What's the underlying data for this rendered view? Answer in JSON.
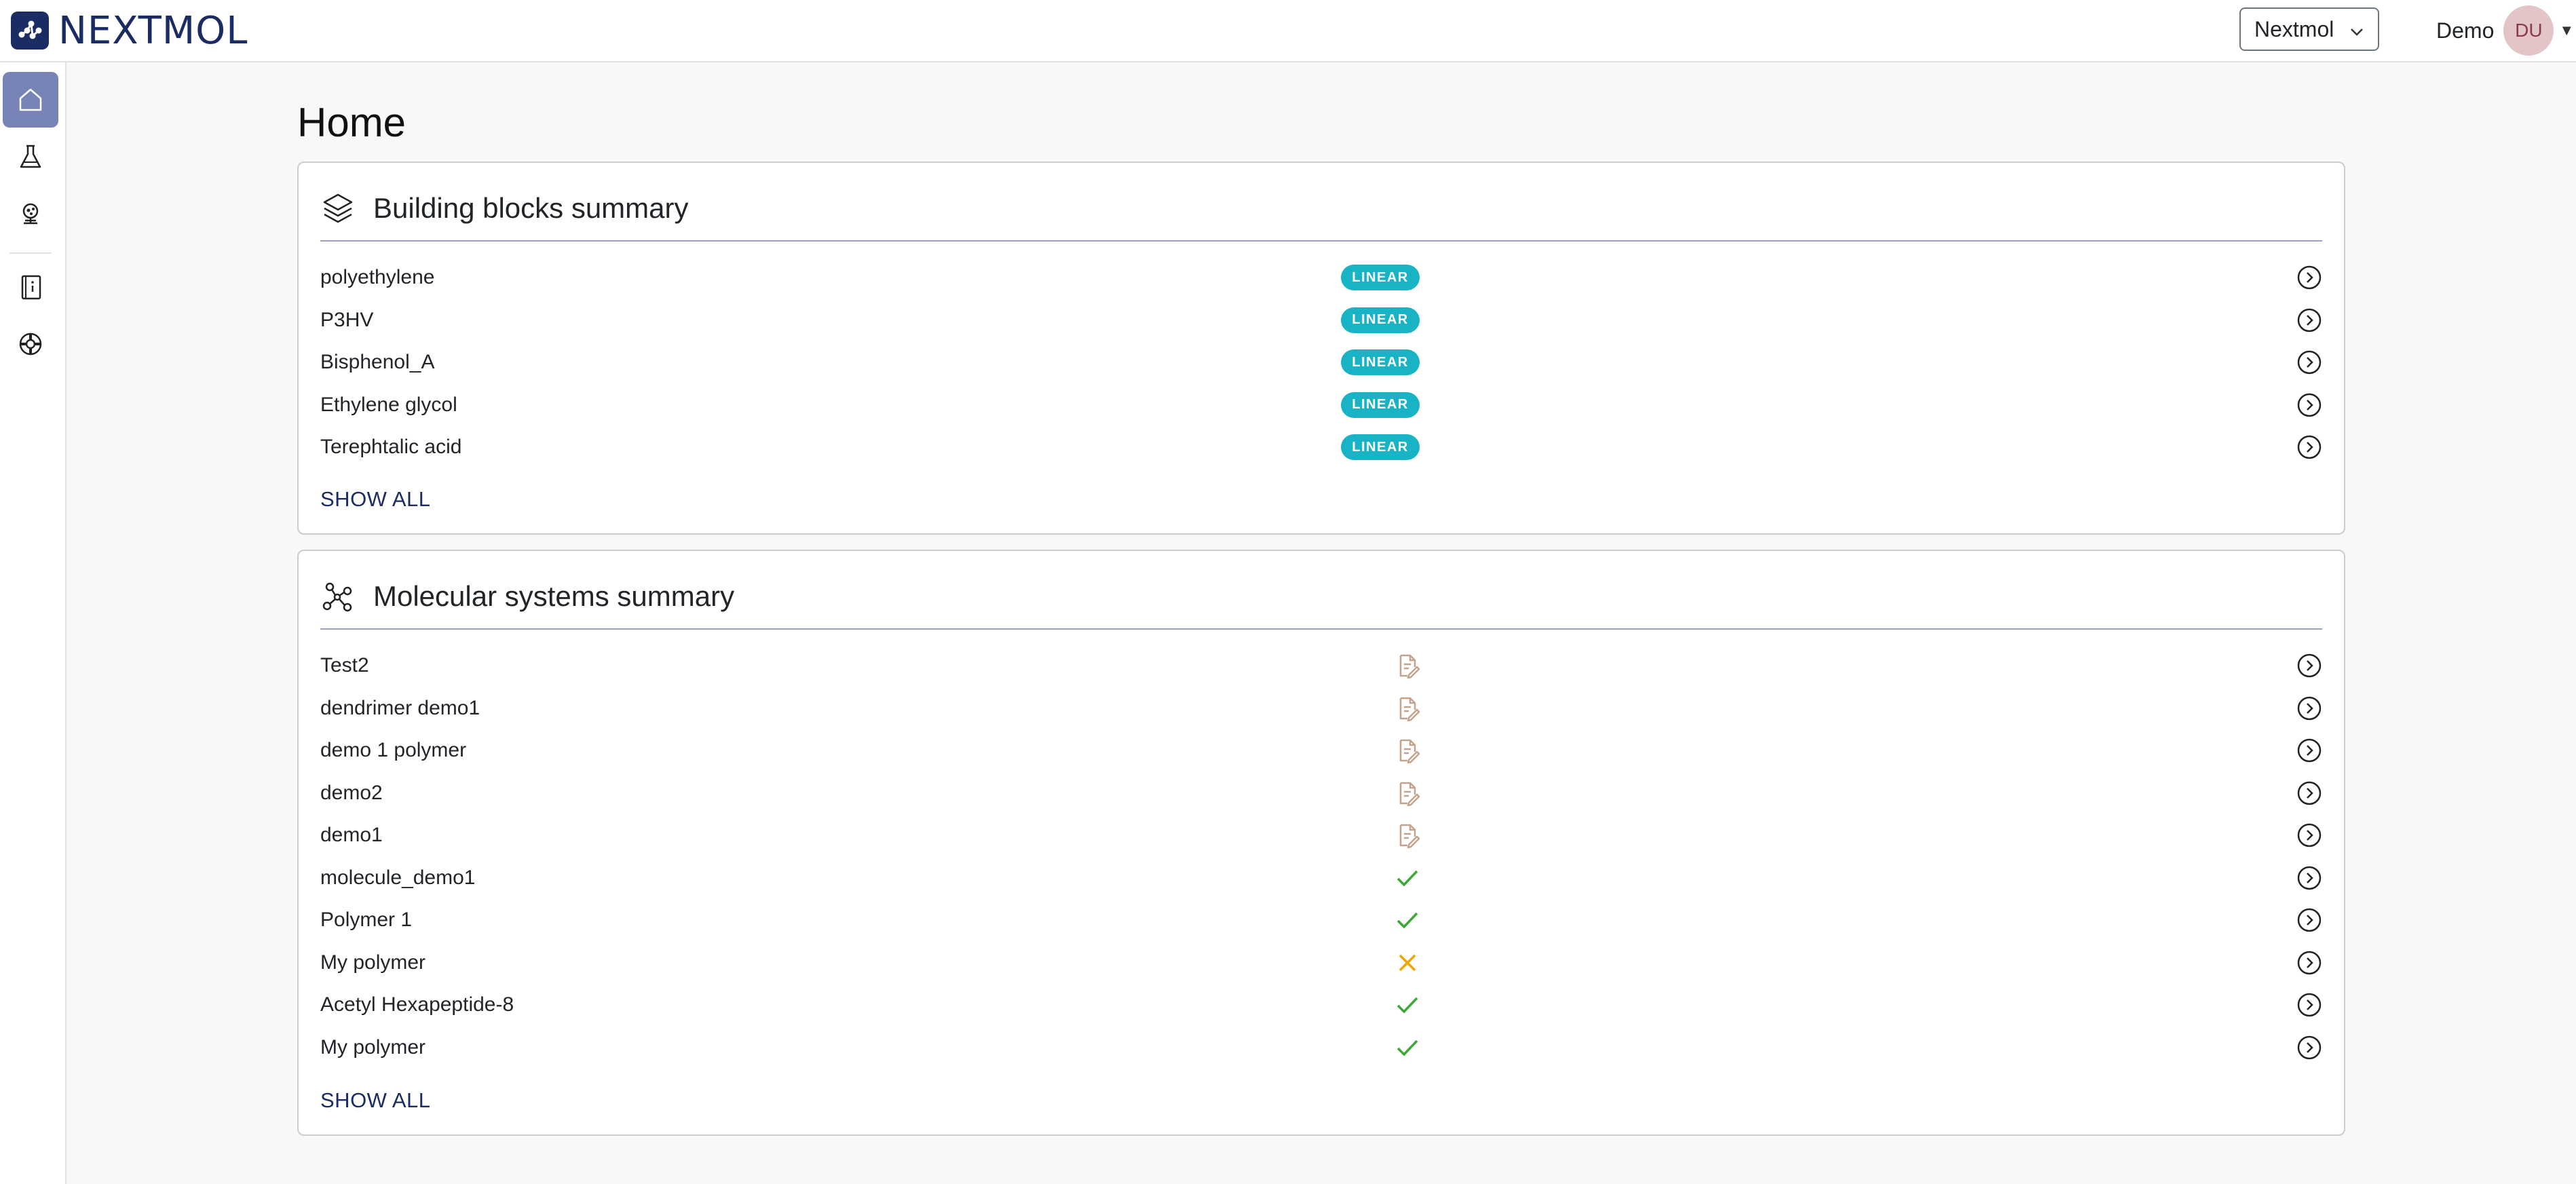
{
  "app": {
    "brand": "NEXTMOL",
    "org_selector": "Nextmol",
    "user_name": "Demo",
    "user_initials": "DU"
  },
  "sidebar": {
    "items": [
      {
        "icon": "home-icon",
        "active": true
      },
      {
        "icon": "flask-icon",
        "active": false
      },
      {
        "icon": "molecule-viewer-icon",
        "active": false
      },
      {
        "icon": "documentation-icon",
        "active": false
      },
      {
        "icon": "support-lifebuoy-icon",
        "active": false
      }
    ]
  },
  "page": {
    "title": "Home"
  },
  "building_blocks": {
    "title": "Building blocks summary",
    "items": [
      {
        "name": "polyethylene",
        "type": "LINEAR"
      },
      {
        "name": "P3HV",
        "type": "LINEAR"
      },
      {
        "name": "Bisphenol_A",
        "type": "LINEAR"
      },
      {
        "name": "Ethylene glycol",
        "type": "LINEAR"
      },
      {
        "name": "Terephtalic acid",
        "type": "LINEAR"
      }
    ],
    "show_all": "SHOW ALL"
  },
  "molecular_systems": {
    "title": "Molecular systems summary",
    "items": [
      {
        "name": "Test2",
        "status": "draft"
      },
      {
        "name": "dendrimer demo1",
        "status": "draft"
      },
      {
        "name": "demo 1 polymer",
        "status": "draft"
      },
      {
        "name": "demo2",
        "status": "draft"
      },
      {
        "name": "demo1",
        "status": "draft"
      },
      {
        "name": "molecule_demo1",
        "status": "success"
      },
      {
        "name": "Polymer 1",
        "status": "success"
      },
      {
        "name": "My polymer",
        "status": "failed"
      },
      {
        "name": "Acetyl Hexapeptide-8",
        "status": "success"
      },
      {
        "name": "My polymer",
        "status": "success"
      }
    ],
    "show_all": "SHOW ALL"
  },
  "colors": {
    "brand": "#1a2c63",
    "sidebar_active": "#7884b5",
    "badge": "#19b3c6",
    "status_success": "#3aa935",
    "status_failed": "#f0a500",
    "status_draft": "#c2a48e"
  }
}
